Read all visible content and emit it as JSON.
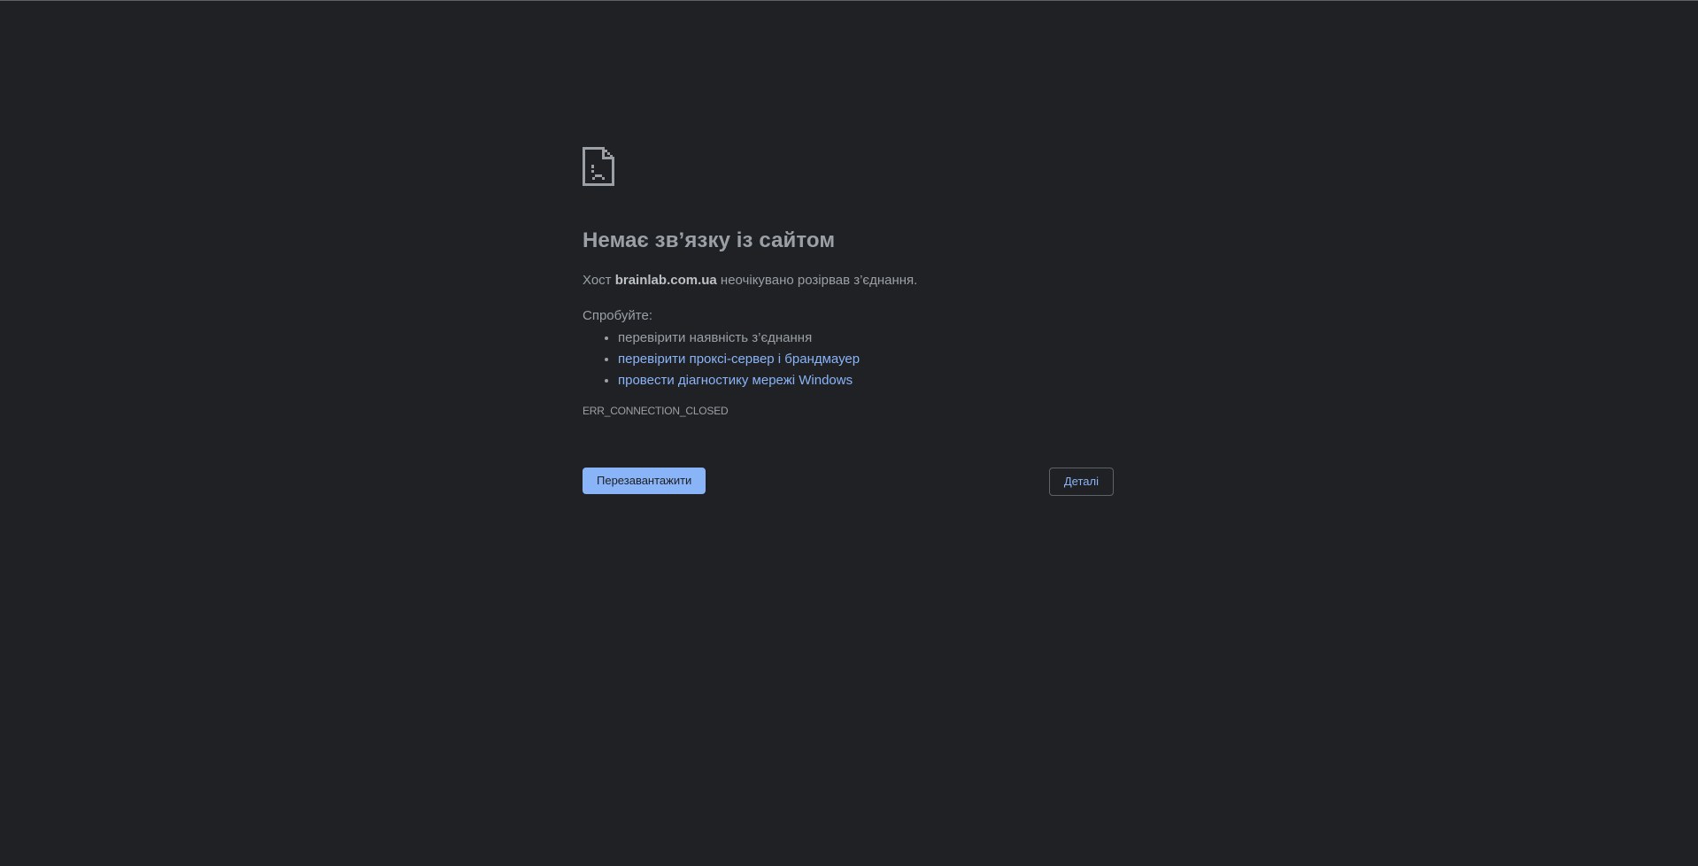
{
  "error": {
    "icon": "sad-page-icon",
    "title": "Немає зв’язку із сайтом",
    "message_prefix": "Хост ",
    "host": "brainlab.com.ua",
    "message_suffix": " неочікувано розірвав з’єднання.",
    "try_label": "Спробуйте:",
    "suggestions": [
      {
        "text": "перевірити наявність з’єднання",
        "link": false
      },
      {
        "text": "перевірити проксі-сервер і брандмауер",
        "link": true
      },
      {
        "text": "провести діагностику мережі Windows",
        "link": true
      }
    ],
    "code": "ERR_CONNECTION_CLOSED"
  },
  "buttons": {
    "reload_label": "Перезавантажити",
    "details_label": "Деталі"
  },
  "colors": {
    "background": "#202124",
    "text": "#9aa0a6",
    "link": "#8ab4f8",
    "button_primary": "#8ab4f8"
  }
}
